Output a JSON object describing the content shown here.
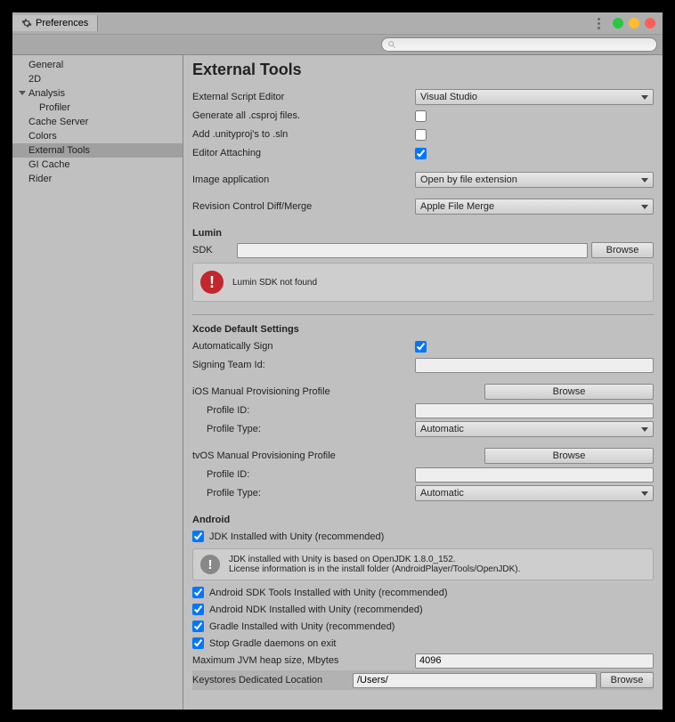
{
  "tab_title": "Preferences",
  "sidebar": {
    "items": [
      "General",
      "2D",
      "Analysis",
      "Profiler",
      "Cache Server",
      "Colors",
      "External Tools",
      "GI Cache",
      "Rider"
    ]
  },
  "page": {
    "title": "External Tools",
    "script_editor_label": "External Script Editor",
    "script_editor_value": "Visual Studio",
    "gen_csproj_label": "Generate all .csproj files.",
    "add_unityproj_label": "Add .unityproj's to .sln",
    "editor_attaching_label": "Editor Attaching",
    "image_app_label": "Image application",
    "image_app_value": "Open by file extension",
    "rev_control_label": "Revision Control Diff/Merge",
    "rev_control_value": "Apple File Merge",
    "lumin_head": "Lumin",
    "sdk_label": "SDK",
    "browse_label": "Browse",
    "lumin_warn": "Lumin SDK not found",
    "xcode_head": "Xcode Default Settings",
    "auto_sign_label": "Automatically Sign",
    "team_id_label": "Signing Team Id:",
    "ios_prov_label": "iOS Manual Provisioning Profile",
    "tvos_prov_label": "tvOS Manual Provisioning Profile",
    "profile_id_label": "Profile ID:",
    "profile_type_label": "Profile Type:",
    "profile_type_value": "Automatic",
    "android_head": "Android",
    "jdk_label": "JDK Installed with Unity (recommended)",
    "jdk_info_1": "JDK installed with Unity is based on OpenJDK 1.8.0_152.",
    "jdk_info_2": "License information is in the install folder (AndroidPlayer/Tools/OpenJDK).",
    "sdk_tools_label": "Android SDK Tools Installed with Unity (recommended)",
    "ndk_label": "Android NDK Installed with Unity (recommended)",
    "gradle_label": "Gradle Installed with Unity (recommended)",
    "stop_gradle_label": "Stop Gradle daemons on exit",
    "jvm_heap_label": "Maximum JVM heap size, Mbytes",
    "jvm_heap_value": "4096",
    "keystore_label": "Keystores Dedicated Location",
    "keystore_value": "/Users/"
  }
}
